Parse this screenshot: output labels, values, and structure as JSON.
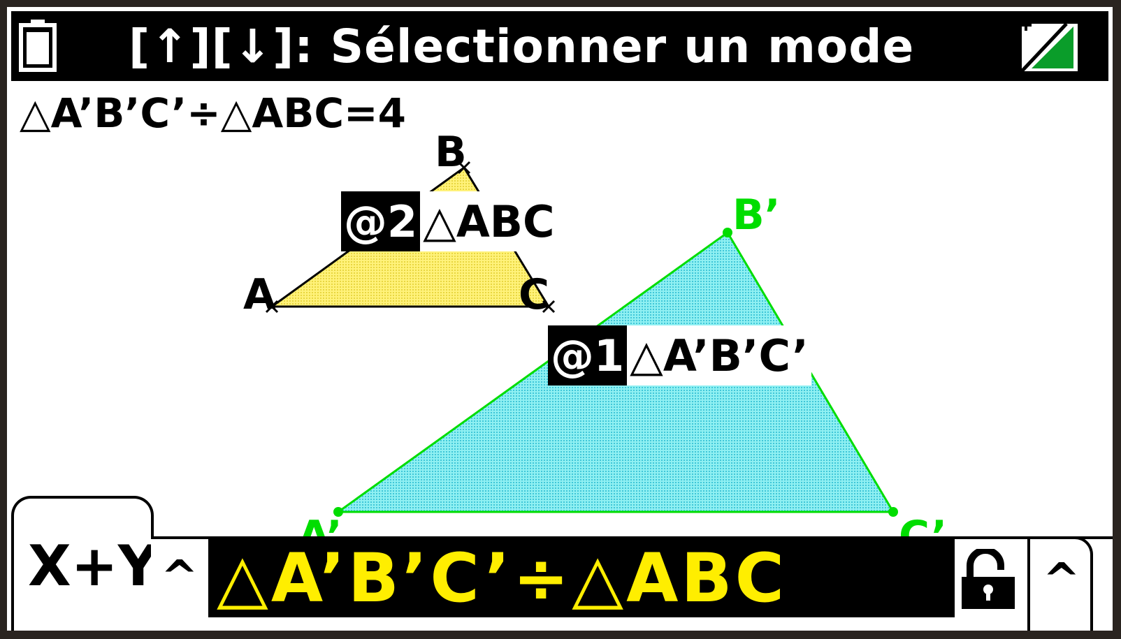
{
  "header": {
    "title": "[↑][↓]: Sélectionner un mode",
    "battery_icon": "battery-icon",
    "signal_icon": "shift-signal-icon"
  },
  "expression": "△A’B’C’÷△ABC=4",
  "geometry": {
    "points": {
      "A": "A",
      "B": "B",
      "C": "C",
      "A_prime": "A’",
      "B_prime": "B’",
      "C_prime": "C’"
    },
    "colors": {
      "small_fill": "#fff27a",
      "big_fill": "#7fe4ea",
      "big_stroke": "#00dd00",
      "small_stroke": "#000000"
    }
  },
  "labels": {
    "tri_abc": {
      "tag": "@2",
      "name": "△ABC"
    },
    "tri_apbpcp": {
      "tag": "@1",
      "name": "△A’B’C’"
    }
  },
  "bottom": {
    "tab_label": "X+Y",
    "caret_left": "^",
    "formula": "△A’B’C’÷△ABC",
    "lock_icon": "unlocked-padlock-icon",
    "caret_right": "^",
    "colors": {
      "formula_text": "#ffee00",
      "formula_bg": "#000000"
    }
  }
}
